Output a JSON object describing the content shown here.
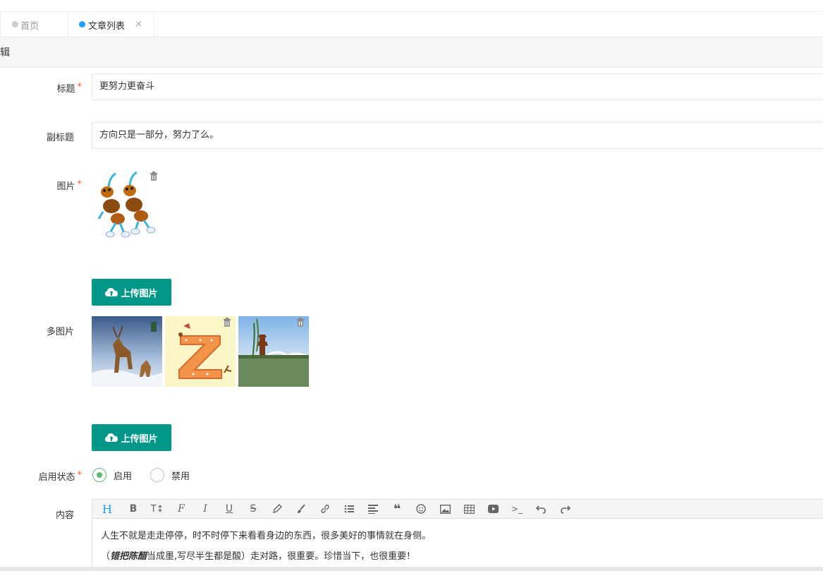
{
  "tabs": [
    {
      "label": "首页",
      "active": false
    },
    {
      "label": "文章列表",
      "active": true,
      "close": "×"
    }
  ],
  "breadcrumb": {
    "text": "辑"
  },
  "form": {
    "title": {
      "label": "标题",
      "required": "*",
      "value": "更努力更奋斗"
    },
    "subtitle": {
      "label": "副标题",
      "value": "方向只是一部分，努力了么。"
    },
    "image": {
      "label": "图片",
      "required": "*",
      "upload_label": "上传图片"
    },
    "multi_image": {
      "label": "多图片",
      "upload_label": "上传图片"
    },
    "status": {
      "label": "启用状态",
      "required": "*",
      "options": [
        {
          "label": "启用",
          "checked": true
        },
        {
          "label": "禁用",
          "checked": false
        }
      ]
    },
    "content": {
      "label": "内容",
      "toolbar": [
        "heading-icon",
        "bold-icon",
        "font-size-icon",
        "font-icon",
        "italic-icon",
        "underline-icon",
        "strikethrough-icon",
        "pen-icon",
        "brush-icon",
        "link-icon",
        "list-icon",
        "align-icon",
        "quote-icon",
        "emoji-icon",
        "image-icon",
        "table-icon",
        "video-icon",
        "code-icon",
        "undo-icon",
        "redo-icon"
      ],
      "heading_glyph": "H",
      "bold_glyph": "B",
      "fontsize_glyph": "T↕",
      "font_glyph": "F",
      "italic_glyph": "I",
      "underline_glyph": "U",
      "strike_glyph": "S",
      "quote_glyph": "❝",
      "code_glyph": ">_",
      "paragraph1": "人生不就是走走停停，时不时停下来看看身边的东西，很多美好的事情就在身侧。",
      "paragraph2_prefix": "（",
      "paragraph2_em": "错把陈醋",
      "paragraph2_rest": "当成墨,写尽半生都是酸）走对路，很重要。珍惜当下，也很重要！"
    }
  },
  "colors": {
    "primary": "#009688",
    "accent_blue": "#1e9fff",
    "required": "#ff5722",
    "radio_checked": "#5FB878"
  }
}
